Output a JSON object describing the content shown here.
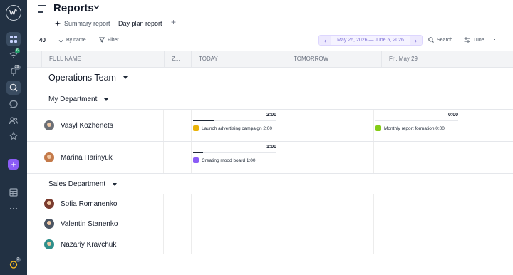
{
  "header": {
    "title": "Reports",
    "tabs": [
      {
        "label": "Summary report"
      },
      {
        "label": "Day plan report"
      }
    ]
  },
  "toolbar": {
    "count": "40",
    "sort_label": "By name",
    "filter_label": "Filter",
    "date_range": "May 26, 2026 — June 5, 2026",
    "search_label": "Search",
    "tune_label": "Tune"
  },
  "sidebar": {
    "badges": [
      "6",
      "29"
    ],
    "timer_badge": "2"
  },
  "columns": [
    "FULL NAME",
    "Z...",
    "TODAY",
    "TOMORROW",
    "Fri, May 29"
  ],
  "team": "Operations Team",
  "groups": [
    {
      "name": "My Department",
      "people": [
        {
          "name": "Vasyl Kozhenets",
          "today": {
            "time": "2:00",
            "progress": 0.25,
            "task": "Launch advertising campaign 2:00",
            "task_color": "#eab308"
          },
          "fri": {
            "time": "0:00",
            "progress": 0,
            "task": "Monthly report formation 0:00",
            "task_color": "#84cc16"
          }
        },
        {
          "name": "Marina Harinyuk",
          "today": {
            "time": "1:00",
            "progress": 0.12,
            "task": "Creating mood board 1:00",
            "task_color": "#8b5cf6"
          }
        }
      ]
    },
    {
      "name": "Sales Department",
      "people": [
        {
          "name": "Sofia Romanenko"
        },
        {
          "name": "Valentin Stanenko"
        },
        {
          "name": "Nazariy Kravchuk"
        }
      ]
    }
  ]
}
